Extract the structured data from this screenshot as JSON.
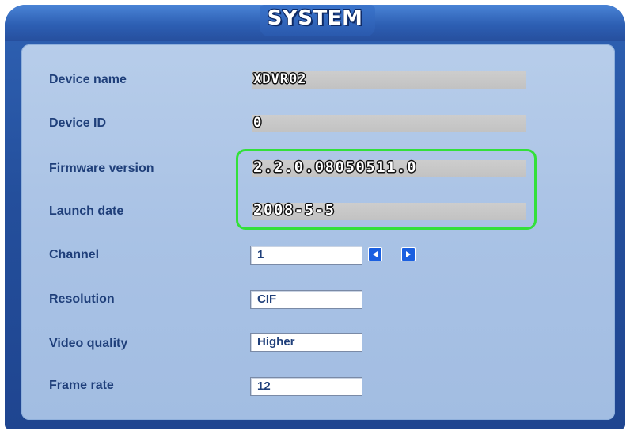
{
  "window": {
    "title": "SYSTEM"
  },
  "info": {
    "device_name": {
      "label": "Device name",
      "value": "XDVR02"
    },
    "device_id": {
      "label": "Device ID",
      "value": "0"
    },
    "firmware_version": {
      "label": "Firmware version",
      "value": "2.2.0.08050511.0"
    },
    "launch_date": {
      "label": "Launch date",
      "value": "2008-5-5"
    }
  },
  "settings": {
    "channel": {
      "label": "Channel",
      "value": "1"
    },
    "resolution": {
      "label": "Resolution",
      "value": "CIF"
    },
    "video_quality": {
      "label": "Video quality",
      "value": "Higher"
    },
    "frame_rate": {
      "label": "Frame rate",
      "value": "12"
    }
  },
  "icons": {
    "prev": "arrow-left-icon",
    "next": "arrow-right-icon"
  },
  "colors": {
    "highlight": "#33e03a",
    "panel": "#a9c2e5",
    "frame": "#244f9c",
    "arrow": "#1a5fe0"
  }
}
